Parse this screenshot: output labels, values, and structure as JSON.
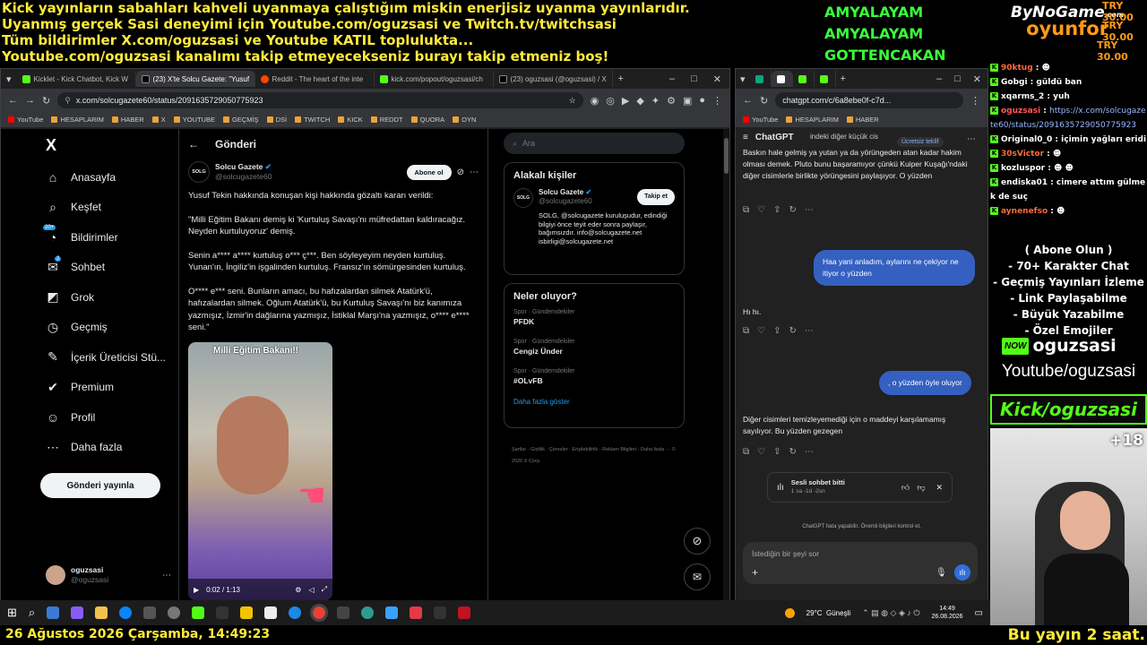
{
  "overlay": {
    "ticker": [
      "Kick yayınların sabahları kahveli uyanmaya çalıştığım miskin enerjisiz uyanma yayınlarıdır.",
      "Uyanmış gerçek Sasi deneyimi için Youtube.com/oguzsasi ve Twitch.tv/twitchsasi",
      "Tüm bildirimler X.com/oguzsasi ve Youtube KATIL toplulukta...",
      "Youtube.com/oguzsasi kanalımı takip etmeyecekseniz burayı takip etmeniz boş!"
    ],
    "amy": [
      "AMYALAYAM",
      "AMYALAYAM",
      "GOTTENCAKAN"
    ],
    "brand_top": "ByNoGame",
    "brand_com": ".com",
    "brand_bottom": "oyunfor",
    "try": [
      "TRY 30.00",
      "TRY 30.00",
      "TRY 30.00"
    ],
    "bottom_left": "26 Ağustos 2026 Çarşamba, 14:49:23",
    "bottom_right": "Bu yayın 2 saat.",
    "promo": [
      "( Abone Olun )",
      "- 70+ Karakter Chat",
      "- Geçmiş Yayınları İzleme",
      "- Link Paylaşabilme",
      "- Büyük Yazabilme",
      "- Özel Emojiler"
    ],
    "now_name": "oguzsasi",
    "yt": "Youtube/oguzsasi",
    "kick": "Kick/oguzsasi",
    "viewer_plus": "+18"
  },
  "chat": [
    {
      "user": "90ktug",
      "sep": " : ",
      "msg": "☻",
      "color": "#ff6b3d"
    },
    {
      "user": "Gobgi",
      "sep": " : ",
      "msg": "güldü ban",
      "color": "#fff"
    },
    {
      "user": "xqarms_2",
      "sep": " : ",
      "msg": "yuh",
      "color": "#fff"
    },
    {
      "user": "oguzsasi",
      "sep": " : ",
      "msg": "https://x.com/solcugazete60/status/2091635729050775923",
      "color": "#ff5a5a"
    },
    {
      "user": "Original0_0",
      "sep": " : ",
      "msg": "içimin yağları eridi",
      "color": "#fff"
    },
    {
      "user": "30sVictor",
      "sep": " : ",
      "msg": "☻",
      "color": "#ff6b3d"
    },
    {
      "user": "kozluspor",
      "sep": " : ",
      "msg": "☻ ☻",
      "color": "#fff"
    },
    {
      "user": "endiska01",
      "sep": " : ",
      "msg": "cimere attım gülmek de suç",
      "color": "#fff"
    },
    {
      "user": "aynenefso",
      "sep": " : ",
      "msg": "☻",
      "color": "#ff6b3d"
    }
  ],
  "browser_left": {
    "tabs": [
      "Kicklet - Kick Chatbot, Kick W",
      "(23) X'te Solcu Gazete: \"Yusuf",
      "Reddit - The heart of the inte",
      "kick.com/popout/oguzsasi/ch",
      "(23) oguzsasi (@oguzsasi) / X"
    ],
    "url": "x.com/solcugazete60/status/2091635729050775923",
    "bookmarks": [
      "YouTube",
      "HESAPLARIM",
      "HABER",
      "X",
      "YOUTUBE",
      "GEÇMİŞ",
      "DSİ",
      "TWITCH",
      "KICK",
      "REDDT",
      "QUORA",
      "OYN"
    ]
  },
  "x": {
    "logo": "X",
    "nav": [
      {
        "icon": "⌂",
        "label": "Anasayfa"
      },
      {
        "icon": "⌕",
        "label": "Keşfet"
      },
      {
        "icon": "◔",
        "label": "Bildirimler",
        "badge": "20+"
      },
      {
        "icon": "✉",
        "label": "Sohbet",
        "badge": "2"
      },
      {
        "icon": "◩",
        "label": "Grok"
      },
      {
        "icon": "◷",
        "label": "Geçmiş"
      },
      {
        "icon": "✎",
        "label": "İçerik Üreticisi Stü..."
      },
      {
        "icon": "✔",
        "label": "Premium"
      },
      {
        "icon": "☺",
        "label": "Profil"
      },
      {
        "icon": "⋯",
        "label": "Daha fazla"
      }
    ],
    "post_button": "Gönderi yayınla",
    "account_name": "oguzsasi",
    "account_handle": "@oguzsasi",
    "header": "Gönderi",
    "author": "Solcu Gazete",
    "author_handle": "@solcugazete60",
    "avatar_text": "SOLG",
    "follow": "Abone ol",
    "post_paragraphs": [
      "Yusuf Tekin hakkında konuşan kişi hakkında gözaltı kararı verildi:",
      "\"Milli Eğitim Bakanı demiş ki 'Kurtuluş Savaşı'nı müfredattan kaldıracağız. Neyden kurtuluyoruz' demiş.",
      "Senin a**** a**** kurtuluş o*** ç***. Ben söyleyeyim neyden kurtuluş. Yunan'ın, İngiliz'in işgalinden kurtuluş. Fransız'ın sömürgesinden kurtuluş.",
      "O**** e*** seni. Bunların amacı, bu hafızalardan silmek Atatürk'ü, hafızalardan silmek. Oğlum Atatürk'ü, bu Kurtuluş Savaşı'nı biz kanımıza yazmışız, İzmir'in dağlarına yazmışız, İstiklal Marşı'na yazmışız, o**** e**** seni.\""
    ],
    "video_caption": "Milli Eğitim Bakanı!!",
    "video_time": "0:02 / 1:13",
    "search_placeholder": "Ara",
    "related_title": "Alakalı kişiler",
    "related_follow": "Takip et",
    "related_bio": "SOLG, @solcugazete kuruluşudur, edindiği bilgiyi önce teyit eder sonra paylaşır, bağımsızdır. info@solcugazete.net isbirligi@solcugazete.net",
    "trends_title": "Neler oluyor?",
    "trends": [
      {
        "cat": "Spor · Gündemdekiler",
        "name": "PFDK"
      },
      {
        "cat": "Spor · Gündemdekiler",
        "name": "Cengiz Ünder"
      },
      {
        "cat": "Spor · Gündemdekiler",
        "name": "#OLvFB"
      }
    ],
    "show_more": "Daha fazla göster",
    "footer": "Şartlar · Gizlilik · Çerezler · Erişilebilirlik · Reklam Bilgileri · Daha fazla ··· © 2026 X Corp."
  },
  "browser_right": {
    "url": "chatgpt.com/c/6a8ebe0f-c7d...",
    "bookmarks": [
      "YouTube",
      "HESAPLARIM",
      "HABER"
    ]
  },
  "gpt": {
    "title": "ChatGPT",
    "free_offer": "Ücretsiz teklif",
    "msg1_head": "indeki diğer küçük cis",
    "msg1": "Baskın hale gelmiş ya yutan ya da yörüngeden atan kadar hakim olması demek. Pluto bunu başaramıyor çünkü Kuiper Kuşağı'ndaki diğer cisimlerle birlikte yörüngesini paylaşıyor. O yüzden",
    "user1": "Haa yani anladım, aylarını ne çekiyor ne itiyor o yüzden",
    "msg2": "Hı hı.",
    "user2": ", o yüzden öyle oluyor",
    "msg3": "Diğer cisimleri temizleyemediği için o maddeyi karşılamamış sayılıyor. Bu yüzden gezegen",
    "voice_title": "Sesli sohbet bitti",
    "voice_sub": "1 sa -1d -2sn",
    "disclaimer": "ChatGPT hata yapabilir. Önemli bilgileri kontrol et.",
    "input_placeholder": "İstediğin bir şeyi sor"
  },
  "taskbar": {
    "weather": "29°C  Güneşli",
    "time": "14:49",
    "date": "26.08.2026"
  }
}
